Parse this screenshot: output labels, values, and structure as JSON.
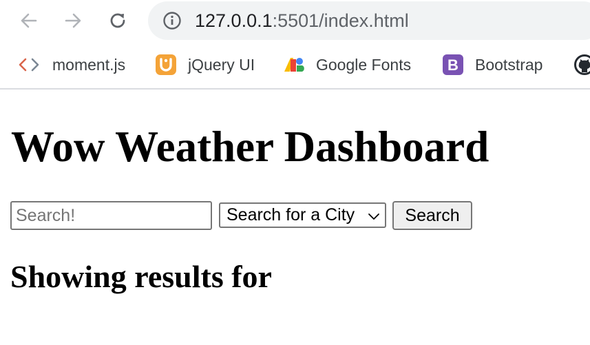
{
  "browser": {
    "url_host": "127.0.0.1",
    "url_rest": ":5501/index.html",
    "bookmarks": [
      {
        "label": "moment.js",
        "icon": "code-brackets-icon"
      },
      {
        "label": "jQuery UI",
        "icon": "jquery-ui-icon"
      },
      {
        "label": "Google Fonts",
        "icon": "google-fonts-icon"
      },
      {
        "label": "Bootstrap",
        "icon": "bootstrap-icon"
      },
      {
        "label": "",
        "icon": "github-icon"
      }
    ]
  },
  "page": {
    "title": "Wow Weather Dashboard",
    "search": {
      "placeholder": "Search!",
      "value": ""
    },
    "city_select": {
      "selected": "Search for a City"
    },
    "search_button": "Search",
    "results_heading": "Showing results for"
  },
  "colors": {
    "omnibox_bg": "#f1f3f4",
    "bootstrap_purple": "#7952b3",
    "jquery_orange": "#f4a338",
    "code_orange": "#d9654b"
  }
}
